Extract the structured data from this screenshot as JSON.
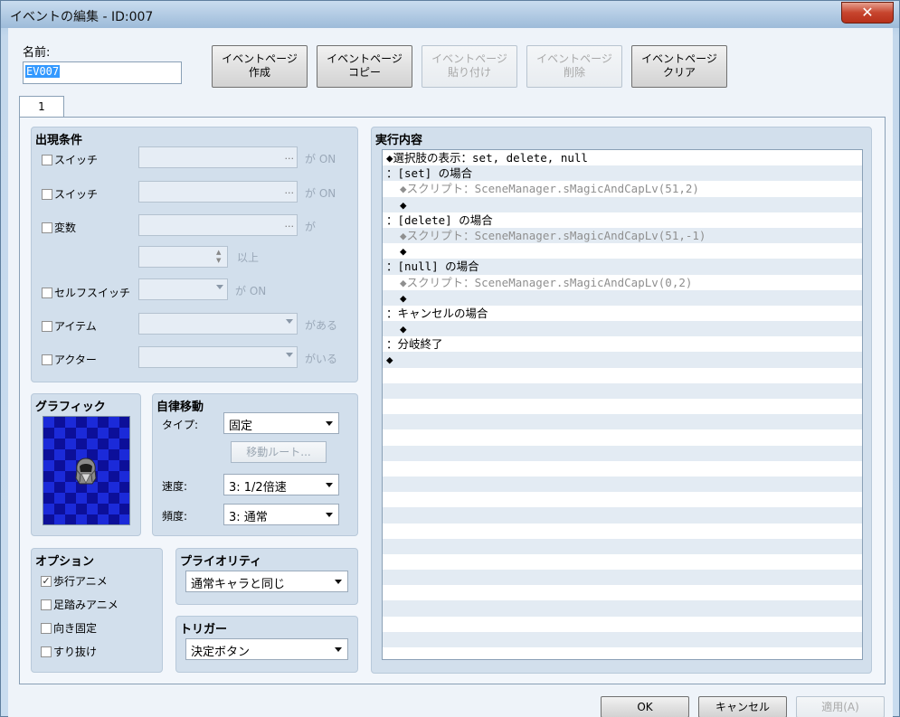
{
  "window": {
    "title": "イベントの編集 - ID:007",
    "close_glyph": "✕"
  },
  "name": {
    "label": "名前:",
    "value": "EV007"
  },
  "page_buttons": [
    {
      "label": "イベントページ\n作成",
      "enabled": true
    },
    {
      "label": "イベントページ\nコピー",
      "enabled": true
    },
    {
      "label": "イベントページ\n貼り付け",
      "enabled": false
    },
    {
      "label": "イベントページ\n削除",
      "enabled": false
    },
    {
      "label": "イベントページ\nクリア",
      "enabled": true
    }
  ],
  "tabs": [
    {
      "label": "1"
    }
  ],
  "conditions": {
    "title": "出現条件",
    "switch1": {
      "label": "スイッチ",
      "suffix": "が ON",
      "dots": "..."
    },
    "switch2": {
      "label": "スイッチ",
      "suffix": "が ON",
      "dots": "..."
    },
    "variable": {
      "label": "変数",
      "suffix": "が",
      "dots": "...",
      "threshold_suffix": "以上"
    },
    "self_switch": {
      "label": "セルフスイッチ",
      "suffix": "が ON"
    },
    "item": {
      "label": "アイテム",
      "suffix": "がある"
    },
    "actor": {
      "label": "アクター",
      "suffix": "がいる"
    }
  },
  "graphic": {
    "title": "グラフィック"
  },
  "autonomous": {
    "title": "自律移動",
    "type_label": "タイプ:",
    "type_value": "固定",
    "route_button": "移動ルート...",
    "speed_label": "速度:",
    "speed_value": "3: 1/2倍速",
    "freq_label": "頻度:",
    "freq_value": "3: 通常"
  },
  "options": {
    "title": "オプション",
    "items": [
      {
        "label": "歩行アニメ",
        "checked": true
      },
      {
        "label": "足踏みアニメ",
        "checked": false
      },
      {
        "label": "向き固定",
        "checked": false
      },
      {
        "label": "すり抜け",
        "checked": false
      }
    ]
  },
  "priority": {
    "title": "プライオリティ",
    "value": "通常キャラと同じ"
  },
  "trigger": {
    "title": "トリガー",
    "value": "決定ボタン"
  },
  "contents": {
    "title": "実行内容",
    "lines": [
      {
        "text": "◆選択肢の表示：set, delete, null",
        "grey": false
      },
      {
        "text": "：[set] の場合",
        "grey": false
      },
      {
        "text": "  ◆スクリプト：SceneManager.sMagicAndCapLv(51,2)",
        "grey": true
      },
      {
        "text": "  ◆",
        "grey": false
      },
      {
        "text": "：[delete] の場合",
        "grey": false
      },
      {
        "text": "  ◆スクリプト：SceneManager.sMagicAndCapLv(51,-1)",
        "grey": true
      },
      {
        "text": "  ◆",
        "grey": false
      },
      {
        "text": "：[null] の場合",
        "grey": false
      },
      {
        "text": "  ◆スクリプト：SceneManager.sMagicAndCapLv(0,2)",
        "grey": true
      },
      {
        "text": "  ◆",
        "grey": false
      },
      {
        "text": "：キャンセルの場合",
        "grey": false
      },
      {
        "text": "  ◆",
        "grey": false
      },
      {
        "text": "：分岐終了",
        "grey": false
      },
      {
        "text": "◆",
        "grey": false
      }
    ]
  },
  "dialog_buttons": {
    "ok": "OK",
    "cancel": "キャンセル",
    "apply": "適用(A)"
  }
}
